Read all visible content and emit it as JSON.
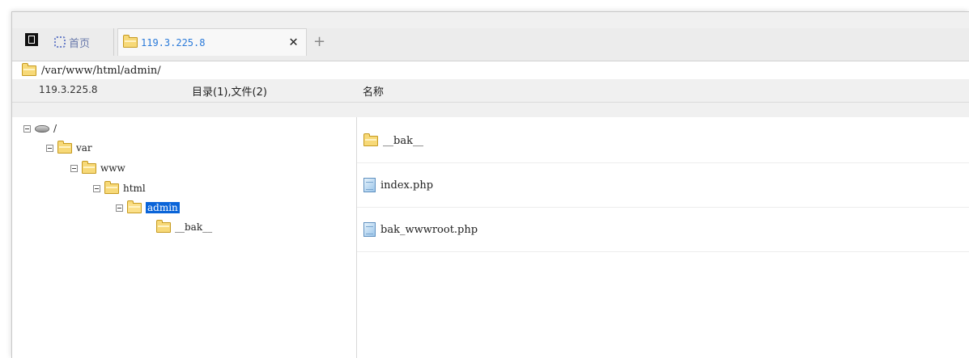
{
  "tabs": {
    "home_label": "首页",
    "active_label": "119.3.225.8",
    "close_glyph": "✕",
    "add_glyph": "+"
  },
  "pathbar": {
    "path": "/var/www/html/admin/"
  },
  "header": {
    "host": "119.3.225.8",
    "count": "目录(1),文件(2)",
    "name_column": "名称"
  },
  "tree": {
    "nodes": [
      {
        "label": "/",
        "icon": "drive-icon"
      },
      {
        "label": "var",
        "icon": "folder-icon"
      },
      {
        "label": "www",
        "icon": "folder-icon"
      },
      {
        "label": "html",
        "icon": "folder-icon"
      },
      {
        "label": "admin",
        "icon": "folder-open-icon",
        "selected": true
      },
      {
        "label": "__bak__",
        "icon": "folder-icon"
      }
    ]
  },
  "files": [
    {
      "name": "__bak__",
      "icon": "folder-icon"
    },
    {
      "name": "index.php",
      "icon": "file-icon"
    },
    {
      "name": "bak_wwwroot.php",
      "icon": "file-icon"
    }
  ],
  "colors": {
    "selection": "#0a64d8",
    "tab_text": "#2a7ad9"
  }
}
